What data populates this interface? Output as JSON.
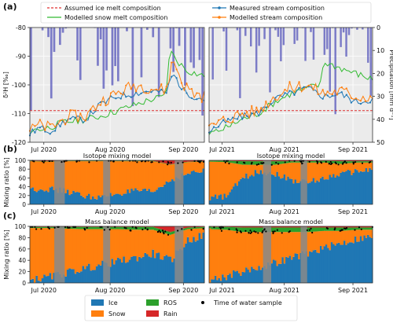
{
  "panels": {
    "a": {
      "letter": "(a)"
    },
    "b": {
      "letter": "(b)"
    },
    "c": {
      "letter": "(c)"
    }
  },
  "chart_data": [
    {
      "id": "a-2020",
      "type": "line",
      "ylabel": "δ²H [‰]",
      "ylim": [
        -120,
        -80
      ],
      "y_ticks": [
        -120,
        -110,
        -100,
        -90,
        -80
      ],
      "x_ticks": [
        "Jul 2020",
        "Aug 2020",
        "Sep 2020"
      ],
      "grid": true,
      "legend_position": "top",
      "series": [
        {
          "name": "Assumed ice melt composition",
          "color": "#e03030",
          "style": "dashed",
          "x": [
            0,
            1
          ],
          "values": [
            -109,
            -109
          ]
        },
        {
          "name": "Modelled snow melt composition",
          "color": "#33bb33",
          "x": [
            0,
            0.1,
            0.2,
            0.32,
            0.4,
            0.5,
            0.6,
            0.7,
            0.78,
            0.8,
            0.85,
            0.9,
            0.95,
            1
          ],
          "values": [
            -116,
            -115,
            -113,
            -112,
            -111,
            -109,
            -107,
            -105,
            -104,
            -88,
            -92,
            -95,
            -96,
            -97
          ]
        },
        {
          "name": "Measured stream composition",
          "color": "#1f77b4",
          "x": [
            0,
            0.05,
            0.12,
            0.22,
            0.32,
            0.4,
            0.5,
            0.6,
            0.7,
            0.78,
            0.82,
            0.88,
            0.94,
            1
          ],
          "values": [
            -117,
            -115,
            -116,
            -112,
            -112,
            -107,
            -104,
            -103,
            -102,
            -103,
            -96,
            -102,
            -104,
            -105
          ]
        },
        {
          "name": "Modelled stream composition",
          "color": "#ff7f0e",
          "x": [
            0,
            0.05,
            0.12,
            0.22,
            0.32,
            0.4,
            0.5,
            0.6,
            0.7,
            0.78,
            0.82,
            0.88,
            0.94,
            1
          ],
          "values": [
            -116,
            -114,
            -115,
            -111,
            -111,
            -106,
            -103,
            -100,
            -101,
            -102,
            -91,
            -100,
            -103,
            -104
          ]
        }
      ],
      "precip_axis": {
        "ylabel": "Precipitation [mm d⁻¹]",
        "ylim": [
          0,
          50
        ],
        "ticks": [
          0,
          10,
          20,
          30,
          40,
          50
        ]
      }
    },
    {
      "id": "a-2021",
      "type": "line",
      "ylim": [
        -120,
        -80
      ],
      "x_ticks": [
        "Jul 2021",
        "Aug 2021",
        "Sep 2021"
      ],
      "grid": true,
      "series": [
        {
          "name": "Assumed ice melt composition",
          "color": "#e03030",
          "style": "dashed",
          "x": [
            0,
            1
          ],
          "values": [
            -109,
            -109
          ]
        },
        {
          "name": "Modelled snow melt composition",
          "color": "#33bb33",
          "x": [
            0,
            0.1,
            0.2,
            0.3,
            0.4,
            0.5,
            0.6,
            0.68,
            0.7,
            0.8,
            0.9,
            1
          ],
          "values": [
            -117,
            -115,
            -112,
            -110,
            -106,
            -103,
            -101,
            -100,
            -92,
            -94,
            -96,
            -98
          ]
        },
        {
          "name": "Measured stream composition",
          "color": "#1f77b4",
          "x": [
            0,
            0.1,
            0.2,
            0.3,
            0.4,
            0.5,
            0.6,
            0.7,
            0.8,
            0.9,
            1
          ],
          "values": [
            -116,
            -113,
            -111,
            -110,
            -105,
            -103,
            -101,
            -104,
            -103,
            -106,
            -105
          ]
        },
        {
          "name": "Modelled stream composition",
          "color": "#ff7f0e",
          "x": [
            0,
            0.1,
            0.2,
            0.3,
            0.4,
            0.5,
            0.6,
            0.7,
            0.8,
            0.9,
            1
          ],
          "values": [
            -115,
            -112,
            -110,
            -109,
            -104,
            -101,
            -100,
            -103,
            -102,
            -104,
            -104
          ]
        }
      ],
      "precip_axis": {
        "ylabel": "Precipitation [mm d⁻¹]",
        "ylim": [
          0,
          50
        ],
        "ticks": [
          0,
          10,
          20,
          30,
          40,
          50
        ]
      }
    },
    {
      "id": "b-2020",
      "type": "area",
      "title": "Isotope mixing model",
      "ylabel": "Mixing ratio [%]",
      "ylim": [
        0,
        100
      ],
      "y_ticks": [
        0,
        20,
        40,
        60,
        80,
        100
      ],
      "x_ticks": [
        "Jul 2020",
        "Aug 2020",
        "Sep 2020"
      ],
      "series": [
        {
          "name": "Ice",
          "color": "#1f77b4",
          "x": [
            0,
            0.1,
            0.2,
            0.3,
            0.4,
            0.5,
            0.6,
            0.7,
            0.8,
            0.9,
            1
          ],
          "values": [
            35,
            35,
            30,
            20,
            15,
            25,
            30,
            28,
            55,
            70,
            75
          ]
        },
        {
          "name": "Snow",
          "color": "#ff7f0e",
          "x": [
            0,
            0.1,
            0.2,
            0.3,
            0.4,
            0.5,
            0.6,
            0.7,
            0.8,
            0.9,
            1
          ],
          "values": [
            63,
            62,
            68,
            78,
            83,
            73,
            68,
            70,
            35,
            26,
            22
          ]
        },
        {
          "name": "ROS",
          "color": "#2ca02c",
          "x": [
            0,
            0.1,
            0.2,
            0.3,
            0.4,
            0.5,
            0.6,
            0.7,
            0.8,
            0.9,
            1
          ],
          "values": [
            1,
            1,
            1,
            1,
            1,
            1,
            1,
            1,
            1,
            1,
            1
          ]
        },
        {
          "name": "Rain",
          "color": "#d62728",
          "x": [
            0,
            0.1,
            0.2,
            0.3,
            0.4,
            0.5,
            0.6,
            0.7,
            0.8,
            0.9,
            1
          ],
          "values": [
            1,
            2,
            1,
            1,
            1,
            1,
            1,
            1,
            9,
            3,
            2
          ]
        }
      ],
      "gaps": [
        [
          0.14,
          0.2
        ],
        [
          0.42,
          0.46
        ],
        [
          0.83,
          0.88
        ]
      ]
    },
    {
      "id": "b-2021",
      "type": "area",
      "title": "Isotope mixing model",
      "ylim": [
        0,
        100
      ],
      "x_ticks": [
        "Jul 2021",
        "Aug 2021",
        "Sep 2021"
      ],
      "series": [
        {
          "name": "Ice",
          "color": "#1f77b4",
          "x": [
            0,
            0.1,
            0.2,
            0.3,
            0.4,
            0.5,
            0.6,
            0.7,
            0.8,
            0.9,
            1
          ],
          "values": [
            15,
            18,
            60,
            75,
            70,
            55,
            50,
            60,
            70,
            75,
            80
          ]
        },
        {
          "name": "Snow",
          "color": "#ff7f0e",
          "x": [
            0,
            0.1,
            0.2,
            0.3,
            0.4,
            0.5,
            0.6,
            0.7,
            0.8,
            0.9,
            1
          ],
          "values": [
            82,
            78,
            30,
            15,
            20,
            40,
            45,
            35,
            22,
            20,
            15
          ]
        },
        {
          "name": "ROS",
          "color": "#2ca02c",
          "x": [
            0,
            0.1,
            0.2,
            0.3,
            0.4,
            0.5,
            0.6,
            0.7,
            0.8,
            0.9,
            1
          ],
          "values": [
            2,
            3,
            8,
            8,
            8,
            3,
            3,
            4,
            6,
            3,
            3
          ]
        },
        {
          "name": "Rain",
          "color": "#d62728",
          "x": [
            0,
            0.1,
            0.2,
            0.3,
            0.4,
            0.5,
            0.6,
            0.7,
            0.8,
            0.9,
            1
          ],
          "values": [
            1,
            1,
            2,
            2,
            2,
            2,
            2,
            1,
            2,
            2,
            2
          ]
        }
      ],
      "gaps": [
        [
          0.33,
          0.38
        ],
        [
          0.56,
          0.6
        ]
      ]
    },
    {
      "id": "c-2020",
      "type": "area",
      "title": "Mass balance model",
      "ylabel": "Mixing ratio [%]",
      "ylim": [
        0,
        100
      ],
      "y_ticks": [
        0,
        20,
        40,
        60,
        80,
        100
      ],
      "x_ticks": [
        "Jul 2020",
        "Aug 2020",
        "Sep 2020"
      ],
      "series": [
        {
          "name": "Ice",
          "color": "#1f77b4",
          "x": [
            0,
            0.1,
            0.2,
            0.3,
            0.4,
            0.5,
            0.6,
            0.7,
            0.8,
            0.9,
            1
          ],
          "values": [
            5,
            10,
            18,
            25,
            32,
            38,
            44,
            52,
            40,
            75,
            85
          ]
        },
        {
          "name": "Snow",
          "color": "#ff7f0e",
          "x": [
            0,
            0.1,
            0.2,
            0.3,
            0.4,
            0.5,
            0.6,
            0.7,
            0.8,
            0.9,
            1
          ],
          "values": [
            92,
            87,
            78,
            70,
            63,
            57,
            50,
            42,
            45,
            20,
            12
          ]
        },
        {
          "name": "ROS",
          "color": "#2ca02c",
          "x": [
            0,
            0.1,
            0.2,
            0.3,
            0.4,
            0.5,
            0.6,
            0.7,
            0.8,
            0.9,
            1
          ],
          "values": [
            2,
            2,
            3,
            4,
            4,
            4,
            5,
            5,
            5,
            3,
            2
          ]
        },
        {
          "name": "Rain",
          "color": "#d62728",
          "x": [
            0,
            0.1,
            0.2,
            0.3,
            0.4,
            0.5,
            0.6,
            0.7,
            0.8,
            0.9,
            1
          ],
          "values": [
            1,
            1,
            1,
            1,
            1,
            1,
            1,
            1,
            10,
            2,
            1
          ]
        }
      ],
      "gaps": [
        [
          0.14,
          0.2
        ],
        [
          0.42,
          0.46
        ],
        [
          0.83,
          0.88
        ]
      ]
    },
    {
      "id": "c-2021",
      "type": "area",
      "title": "Mass balance model",
      "ylim": [
        0,
        100
      ],
      "x_ticks": [
        "Jul 2021",
        "Aug 2021",
        "Sep 2021"
      ],
      "series": [
        {
          "name": "Ice",
          "color": "#1f77b4",
          "x": [
            0,
            0.1,
            0.2,
            0.3,
            0.4,
            0.5,
            0.6,
            0.7,
            0.8,
            0.9,
            1
          ],
          "values": [
            5,
            12,
            20,
            28,
            35,
            45,
            52,
            62,
            70,
            78,
            82
          ]
        },
        {
          "name": "Snow",
          "color": "#ff7f0e",
          "x": [
            0,
            0.1,
            0.2,
            0.3,
            0.4,
            0.5,
            0.6,
            0.7,
            0.8,
            0.9,
            1
          ],
          "values": [
            90,
            82,
            70,
            62,
            55,
            45,
            38,
            30,
            22,
            16,
            12
          ]
        },
        {
          "name": "ROS",
          "color": "#2ca02c",
          "x": [
            0,
            0.1,
            0.2,
            0.3,
            0.4,
            0.5,
            0.6,
            0.7,
            0.8,
            0.9,
            1
          ],
          "values": [
            4,
            5,
            8,
            8,
            8,
            8,
            8,
            6,
            6,
            4,
            4
          ]
        },
        {
          "name": "Rain",
          "color": "#d62728",
          "x": [
            0,
            0.1,
            0.2,
            0.3,
            0.4,
            0.5,
            0.6,
            0.7,
            0.8,
            0.9,
            1
          ],
          "values": [
            1,
            1,
            2,
            2,
            2,
            2,
            2,
            2,
            2,
            2,
            2
          ]
        }
      ],
      "gaps": [
        [
          0.33,
          0.38
        ],
        [
          0.56,
          0.6
        ]
      ]
    }
  ],
  "legend_bottom": {
    "items": [
      {
        "label": "Ice",
        "color": "#1f77b4",
        "kind": "patch"
      },
      {
        "label": "Snow",
        "color": "#ff7f0e",
        "kind": "patch"
      },
      {
        "label": "ROS",
        "color": "#2ca02c",
        "kind": "patch"
      },
      {
        "label": "Rain",
        "color": "#d62728",
        "kind": "patch"
      },
      {
        "label": "Time of water sample",
        "color": "#000000",
        "kind": "dot"
      }
    ]
  },
  "colors": {
    "precip": "#5555bb",
    "gap": "#8a8a8a",
    "plot_bg": "#ebebeb"
  }
}
